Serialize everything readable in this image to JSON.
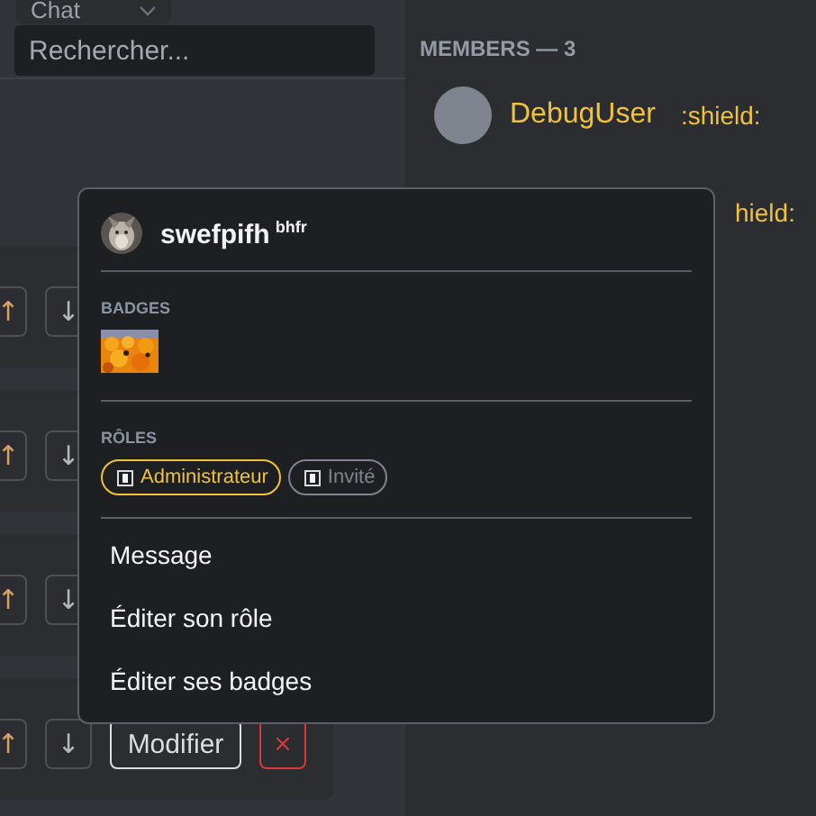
{
  "channel_select": {
    "value": "Chat"
  },
  "search": {
    "placeholder": "Rechercher..."
  },
  "rows": [
    {
      "up": "↑",
      "down": "↓"
    },
    {
      "up": "↑",
      "down": "↓"
    },
    {
      "up": "↑",
      "down": "↓"
    },
    {
      "up": "↑",
      "down": "↓",
      "edit": "Modifier",
      "delete": "×"
    }
  ],
  "members": {
    "title": "MEMBERS — 3",
    "items": [
      {
        "name": "DebugUser",
        "tag": ":shield:",
        "color": "#f0c23b"
      },
      {
        "tag": "hield:",
        "color": "#f0c23b"
      }
    ]
  },
  "popup": {
    "name": "swefpifh",
    "subtitle": "bhfr",
    "badges_label": "BADGES",
    "badges": [
      {
        "kind": "picture"
      }
    ],
    "roles_label": "RÔLES",
    "roles": [
      {
        "label": "Administrateur",
        "color": "#f0c23b"
      },
      {
        "label": "Invité",
        "color": "#80848e"
      }
    ],
    "actions": [
      "Message",
      "Éditer son rôle",
      "Éditer ses badges"
    ]
  }
}
